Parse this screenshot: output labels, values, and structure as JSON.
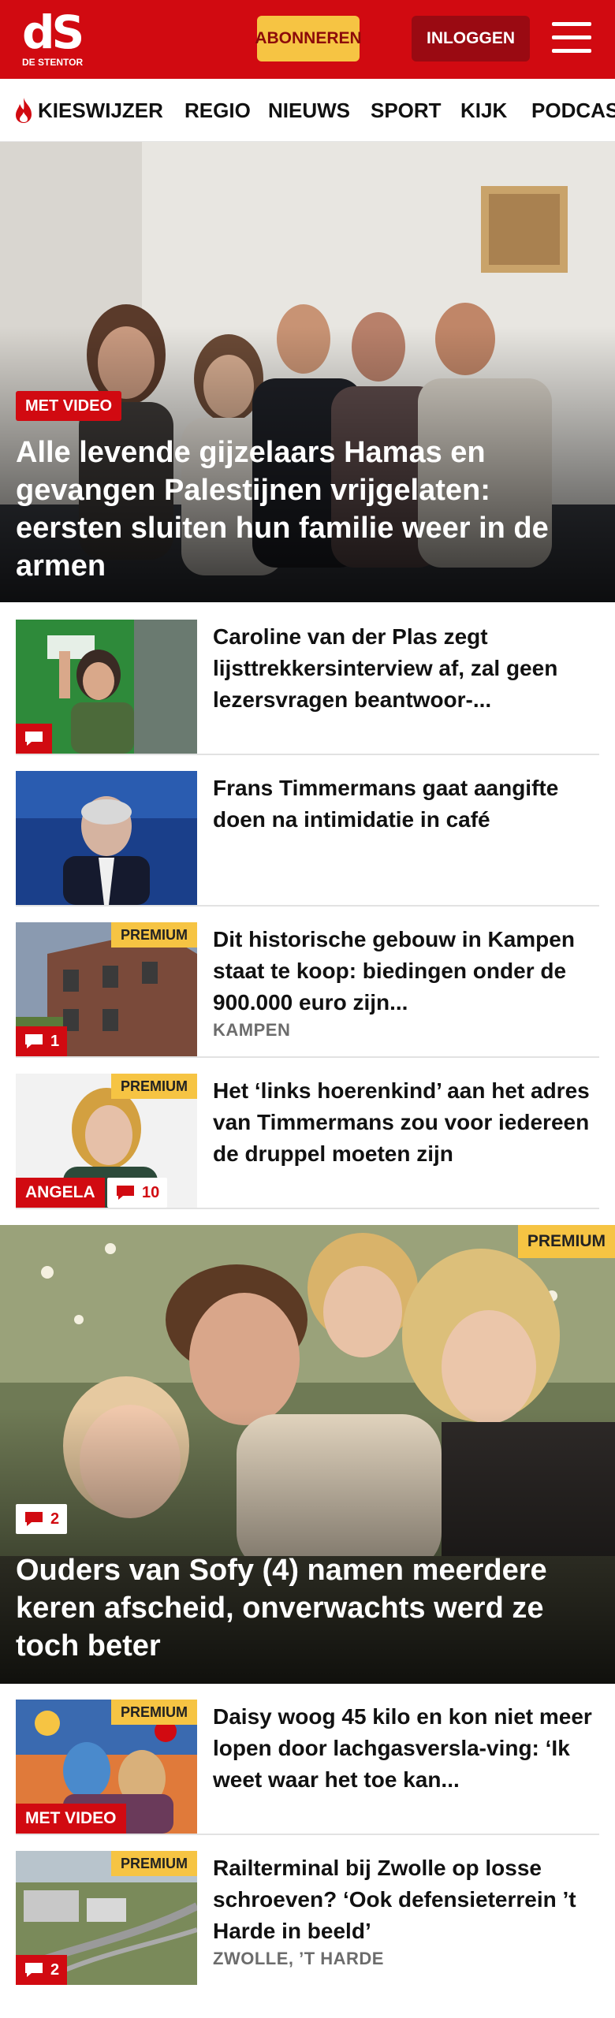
{
  "header": {
    "logo_mark": "dS",
    "logo_sub": "DE STENTOR",
    "subscribe_label": "ABONNEREN",
    "login_label": "INLOGGEN"
  },
  "nav": {
    "items": [
      "KIESWIJZER",
      "REGIO",
      "NIEUWS",
      "SPORT",
      "KIJK",
      "PODCAS"
    ]
  },
  "colors": {
    "brand_red": "#d10a11",
    "premium_yellow": "#f6c443",
    "dark_red": "#9a0a12"
  },
  "hero": {
    "badge": "MET VIDEO",
    "title": "Alle levende gijzelaars Hamas en gevangen Palestijnen vrijgelaten: eersten sluiten hun familie weer in de armen"
  },
  "articles": [
    {
      "title": "Caroline van der Plas zegt lijsttrekkersinterview af, zal geen lezersvragen beantwoor-...",
      "comments": "",
      "meta": "",
      "premium": "",
      "label": ""
    },
    {
      "title": "Frans Timmermans gaat aangifte doen na intimidatie in café",
      "comments": "",
      "meta": "",
      "premium": "",
      "label": ""
    },
    {
      "title": "Dit historische gebouw in Kampen staat te koop: biedingen onder de 900.000 euro zijn...",
      "comments": "1",
      "meta": "KAMPEN",
      "premium": "PREMIUM",
      "label": ""
    },
    {
      "title": "Het ‘links hoerenkind’ aan het adres van Timmermans zou voor iedereen de druppel moeten zijn",
      "comments": "10",
      "meta": "",
      "premium": "PREMIUM",
      "label": "ANGELA"
    }
  ],
  "hero2": {
    "premium": "PREMIUM",
    "comments": "2",
    "title": "Ouders van Sofy (4) namen meerdere keren afscheid, onverwachts werd ze toch beter"
  },
  "articles2": [
    {
      "title": "Daisy woog 45 kilo en kon niet meer lopen door lachgasversla-ving: ‘Ik weet waar het toe kan...",
      "premium": "PREMIUM",
      "label": "MET VIDEO",
      "meta": "",
      "comments": ""
    },
    {
      "title": "Railterminal bij Zwolle op losse schroeven? ‘Ook defensieterrein ’t Harde in beeld’",
      "premium": "PREMIUM",
      "label": "",
      "meta": "ZWOLLE, ’T HARDE",
      "comments": "2"
    }
  ]
}
